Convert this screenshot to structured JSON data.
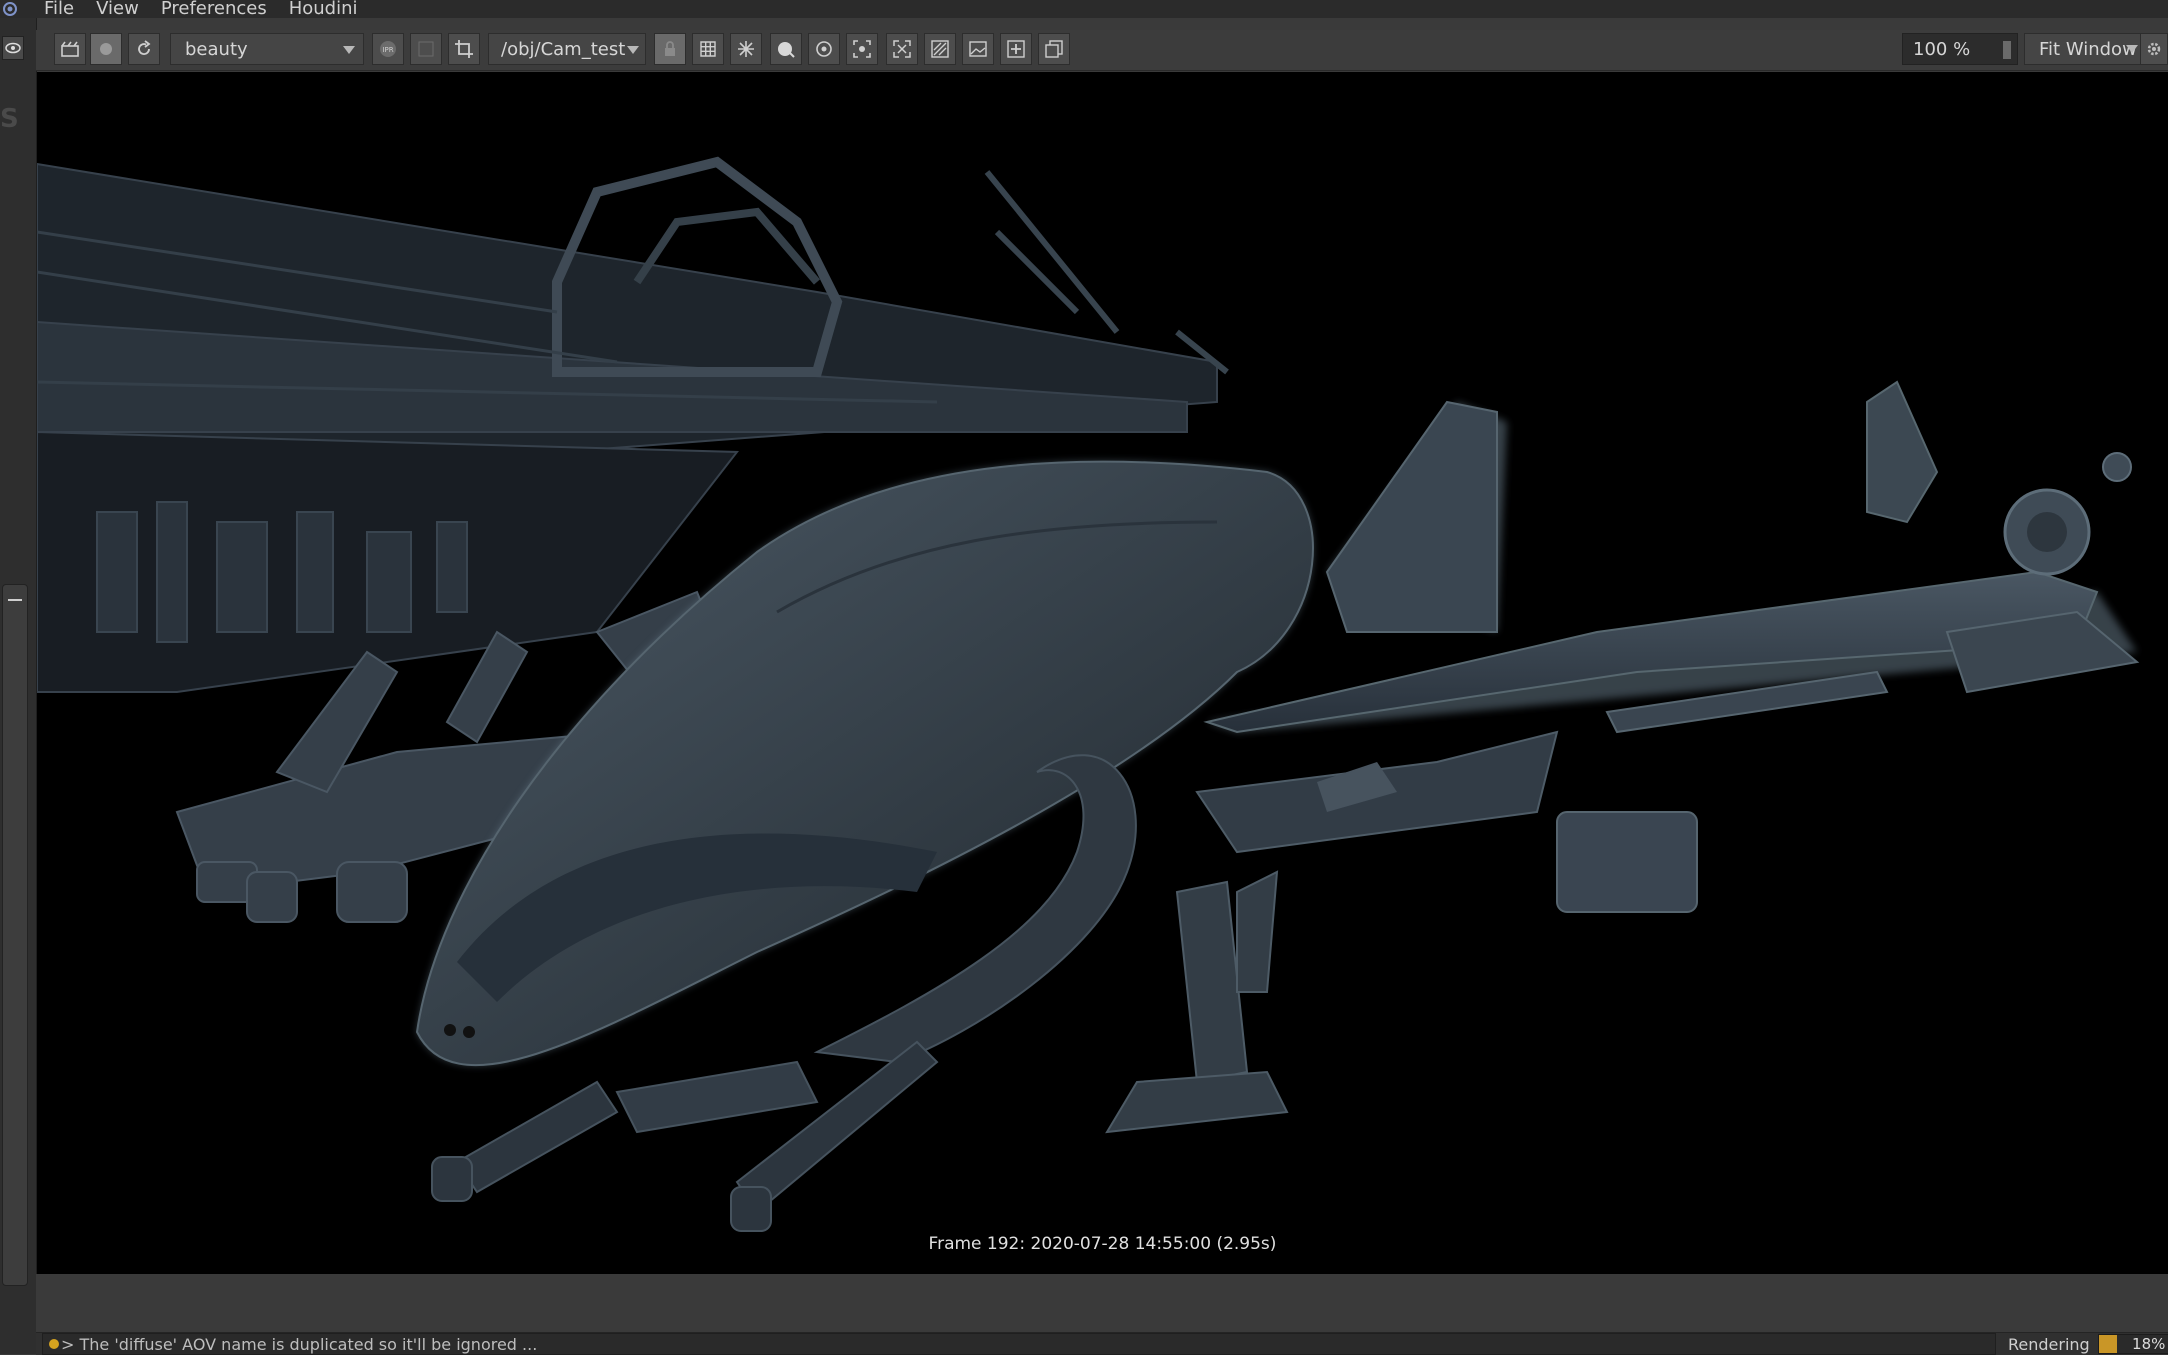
{
  "menu": {
    "items": [
      "File",
      "View",
      "Preferences",
      "Houdini"
    ]
  },
  "toolbar": {
    "aov_select": "beauty",
    "camera_path": "/obj/Cam_test",
    "zoom": "100 %",
    "fit_mode": "Fit Window"
  },
  "viewport": {
    "frame_info": "Frame  192:  2020-07-28  14:55:00  (2.95s)"
  },
  "status": {
    "message": "> The 'diffuse' AOV name is duplicated so it'll be ignored ...",
    "render_label": "Rendering",
    "progress_text": "18%",
    "progress_value": 0.18
  },
  "colors": {
    "accent": "#c99627",
    "warning_dot": "#d4a21f",
    "viewport_bg": "#000000",
    "model_tint": "#3a4650"
  },
  "icons": {
    "toolbar_left": [
      "clapper-icon",
      "render-circle-icon",
      "refresh-icon"
    ],
    "toolbar_mid": [
      "snapshot-icon",
      "grid-dim-icon",
      "crop-icon"
    ],
    "toolbar_right": [
      "lock-icon",
      "grid-icon",
      "snowflake-icon",
      "sphere-icon",
      "target-icon",
      "focus-frame-icon",
      "expand-icon",
      "slash-region-icon",
      "image-icon",
      "add-image-icon",
      "copy-icon"
    ]
  }
}
